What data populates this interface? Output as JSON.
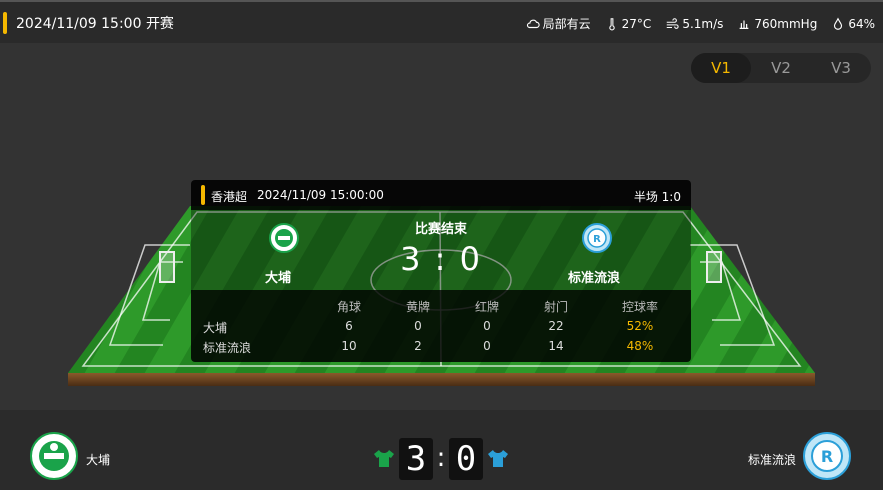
{
  "header": {
    "kickoff": "2024/11/09 15:00 开赛"
  },
  "weather": {
    "condition": "局部有云",
    "temperature": "27°C",
    "wind": "5.1m/s",
    "pressure": "760mmHg",
    "humidity": "64%"
  },
  "version_switch": [
    "V1",
    "V2",
    "V3"
  ],
  "active_version": "V1",
  "match_card": {
    "league": "香港超",
    "datetime": "2024/11/09 15:00:00",
    "half_time": "半场 1:0",
    "status": "比赛结束",
    "score_text": "3 : 0",
    "home_name": "大埔",
    "away_name": "标准流浪",
    "stat_headers": [
      "角球",
      "黄牌",
      "红牌",
      "射门",
      "控球率"
    ],
    "home_stats": [
      "6",
      "0",
      "0",
      "22",
      "52%"
    ],
    "away_stats": [
      "10",
      "2",
      "0",
      "14",
      "48%"
    ]
  },
  "scoreboard": {
    "home_name": "大埔",
    "away_name": "标准流浪",
    "home_score": "3",
    "away_score": "0",
    "separator": ":"
  },
  "colors": {
    "accent": "#f5b800",
    "home_shirt": "#1aa34a",
    "away_shirt": "#2b9fd8",
    "pitch_light": "#2f9a2a",
    "pitch_dark": "#1e7d1a"
  },
  "icons": {
    "weather": "cloud-icon",
    "temperature": "thermometer-icon",
    "wind": "wind-icon",
    "pressure": "pressure-icon",
    "humidity": "droplet-icon"
  }
}
